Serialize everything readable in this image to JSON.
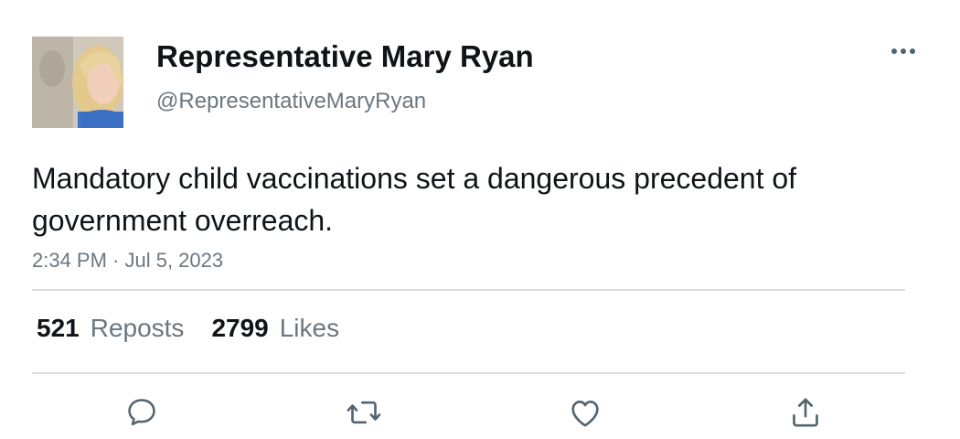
{
  "author": {
    "display_name": "Representative Mary Ryan",
    "handle": "@RepresentativeMaryRyan",
    "avatar_icon": "profile-photo"
  },
  "tweet": {
    "text": "Mandatory child vaccinations set a dangerous precedent of government overreach.",
    "timestamp": "2:34 PM · Jul 5, 2023"
  },
  "stats": {
    "reposts_count": "521",
    "reposts_label": "Reposts",
    "likes_count": "2799",
    "likes_label": "Likes"
  },
  "actions": {
    "reply_icon": "reply-icon",
    "repost_icon": "repost-icon",
    "like_icon": "like-icon",
    "share_icon": "share-icon",
    "more_icon": "more-icon"
  },
  "colors": {
    "text_primary": "#0f1419",
    "text_secondary": "#6b7780",
    "divider": "#d7dde2",
    "icon": "#536471"
  }
}
